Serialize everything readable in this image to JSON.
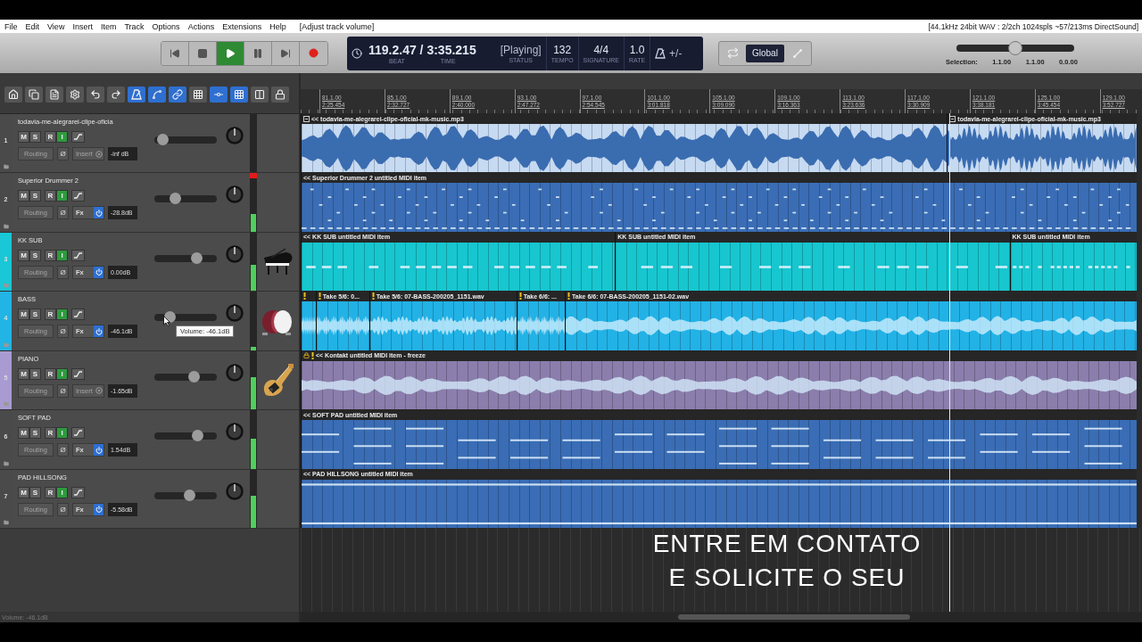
{
  "menu": [
    "File",
    "Edit",
    "View",
    "Insert",
    "Item",
    "Track",
    "Options",
    "Actions",
    "Extensions",
    "Help"
  ],
  "action_hint": "[Adjust track volume]",
  "audio_status": "[44.1kHz 24bit WAV : 2/2ch 1024spls ~57/213ms DirectSound]",
  "transport": {
    "buttons": [
      {
        "kind": "start",
        "selected": false
      },
      {
        "kind": "stop",
        "selected": false
      },
      {
        "kind": "play",
        "selected": true
      },
      {
        "kind": "pause",
        "selected": false
      },
      {
        "kind": "end",
        "selected": false
      },
      {
        "kind": "record",
        "selected": false
      }
    ],
    "position": "119.2.47 / 3:35.215",
    "position_labels": [
      "BEAT",
      "TIME"
    ],
    "fields": [
      {
        "value": "[Playing]",
        "label": "STATUS"
      },
      {
        "value": "132",
        "label": "TEMPO"
      },
      {
        "value": "4/4",
        "label": "SIGNATURE"
      },
      {
        "value": "1.0",
        "label": "RATE"
      }
    ],
    "metronome": "+/-",
    "mode": "Global",
    "master_slider": {
      "level": 0.5
    },
    "selection": {
      "label": "Selection:",
      "values": [
        "1.1.00",
        "1.1.00",
        "0.0.00"
      ]
    }
  },
  "toolbar": [
    {
      "kind": "home",
      "selected": false
    },
    {
      "kind": "copy",
      "selected": false
    },
    {
      "kind": "file",
      "selected": false
    },
    {
      "kind": "gear",
      "selected": false
    },
    {
      "kind": "undo",
      "selected": false
    },
    {
      "kind": "redo",
      "selected": false
    },
    {
      "kind": "metronome",
      "selected": true
    },
    {
      "kind": "curve",
      "selected": true
    },
    {
      "kind": "link",
      "selected": true
    },
    {
      "kind": "grid",
      "selected": false
    },
    {
      "kind": "snap",
      "selected": true
    },
    {
      "kind": "grid",
      "selected": true
    },
    {
      "kind": "split",
      "selected": false
    },
    {
      "kind": "lock",
      "selected": false
    }
  ],
  "ruler": [
    {
      "bar": "81.1.00",
      "time": "2:25.454"
    },
    {
      "bar": "85.1.00",
      "time": "2:32.727"
    },
    {
      "bar": "89.1.00",
      "time": "2:40.000"
    },
    {
      "bar": "93.1.00",
      "time": "2:47.272"
    },
    {
      "bar": "97.1.00",
      "time": "2:54.545"
    },
    {
      "bar": "101.1.00",
      "time": "3:01.818"
    },
    {
      "bar": "105.1.00",
      "time": "3:09.090"
    },
    {
      "bar": "109.1.00",
      "time": "3:16.363"
    },
    {
      "bar": "113.1.00",
      "time": "3:23.636"
    },
    {
      "bar": "117.1.00",
      "time": "3:30.909"
    },
    {
      "bar": "121.1.00",
      "time": "3:38.181"
    },
    {
      "bar": "125.1.00",
      "time": "3:45.454"
    },
    {
      "bar": "129.1.00",
      "time": "3:52.727"
    }
  ],
  "tracks": [
    {
      "number": "1",
      "name": "todavia-me-alegrarei-clipe-oficia",
      "color": "#4a4a4a",
      "buttons": [
        {
          "label": "M",
          "on": false
        },
        {
          "label": "S",
          "on": false
        },
        {
          "label": "R",
          "on": false
        },
        {
          "label": "I",
          "on": true
        }
      ],
      "routing": "Routing",
      "phase": "Ø",
      "fx_power": false,
      "fx_label": "Insert",
      "volume": "-inf dB",
      "fader": {
        "level": 0.05
      },
      "clip": false,
      "thumbnail": false,
      "items": [
        {
          "kind": "audio",
          "label": "<< todavia-me-alegrarei-clipe-oficial-mk-music.mp3",
          "color": "#c6daf2",
          "take_icon": true,
          "warning": false,
          "locked": false
        },
        {
          "kind": "audio",
          "label": "todavia-me-alegrarei-clipe-oficial-mk-music.mp3",
          "color": "#c6daf2",
          "take_icon": true,
          "warning": false,
          "locked": false
        }
      ]
    },
    {
      "number": "2",
      "name": "Superior Drummer 2",
      "color": "#4a4a4a",
      "buttons": [
        {
          "label": "M",
          "on": false
        },
        {
          "label": "S",
          "on": false
        },
        {
          "label": "R",
          "on": false
        },
        {
          "label": "I",
          "on": true
        }
      ],
      "routing": "Routing",
      "phase": "Ø",
      "fx_power": true,
      "fx_label": "Fx",
      "volume": "-28.8dB",
      "fader": {
        "level": 0.3
      },
      "meter": {
        "level": 0.3
      },
      "clip": true,
      "thumbnail": false,
      "items": [
        {
          "kind": "midi",
          "label": "<< Superior Drummer 2 untitled MIDI item",
          "color": "#3a6db5",
          "take_icon": false,
          "warning": false,
          "locked": false
        }
      ]
    },
    {
      "number": "3",
      "name": "KK SUB",
      "color": "#19c7d6",
      "buttons": [
        {
          "label": "M",
          "on": false
        },
        {
          "label": "S",
          "on": false
        },
        {
          "label": "R",
          "on": false
        },
        {
          "label": "I",
          "on": true
        }
      ],
      "routing": "Routing",
      "phase": "Ø",
      "fx_power": true,
      "fx_label": "Fx",
      "volume": "0.00dB",
      "fader": {
        "level": 0.72
      },
      "meter": {
        "level": 0.45
      },
      "clip": false,
      "thumbnail": true,
      "items": [
        {
          "kind": "midi",
          "label": "<< KK SUB untitled MIDI item",
          "color": "#17c6cf",
          "take_icon": false,
          "warning": false,
          "locked": false
        },
        {
          "kind": "midi",
          "label": "KK SUB untitled MIDI item",
          "color": "#17c6cf",
          "take_icon": false,
          "warning": false,
          "locked": false
        },
        {
          "kind": "midi",
          "label": "KK SUB untitled MIDI item",
          "color": "#17c6cf",
          "take_icon": false,
          "warning": false,
          "locked": false
        }
      ]
    },
    {
      "number": "4",
      "name": "BASS",
      "color": "#22b4e4",
      "buttons": [
        {
          "label": "M",
          "on": false
        },
        {
          "label": "S",
          "on": false
        },
        {
          "label": "R",
          "on": false
        },
        {
          "label": "I",
          "on": true
        }
      ],
      "routing": "Routing",
      "phase": "Ø",
      "fx_power": true,
      "fx_label": "Fx",
      "volume": "-46.1dB",
      "fader": {
        "level": 0.2
      },
      "meter": {
        "level": 0.05
      },
      "clip": false,
      "thumbnail": true,
      "items": [
        {
          "kind": "audio",
          "color": "#22b2e6",
          "take_icon": false,
          "warning": true,
          "locked": false
        },
        {
          "kind": "audio",
          "label": "Take 5/6: 0...",
          "color": "#22b2e6",
          "take_icon": false,
          "warning": true,
          "locked": false
        },
        {
          "kind": "audio",
          "label": "Take 5/6: 07-BASS-200205_1151.wav",
          "color": "#22b2e6",
          "take_icon": false,
          "warning": true,
          "locked": false
        },
        {
          "kind": "audio",
          "label": "Take 6/6: ...",
          "color": "#22b2e6",
          "take_icon": false,
          "warning": true,
          "locked": false
        },
        {
          "kind": "audio",
          "label": "Take 6/6: 07-BASS-200205_1151-02.wav",
          "color": "#22b2e6",
          "take_icon": false,
          "warning": true,
          "locked": false
        }
      ]
    },
    {
      "number": "5",
      "name": "PIANO",
      "color": "#a99bd2",
      "buttons": [
        {
          "label": "M",
          "on": false
        },
        {
          "label": "S",
          "on": false
        },
        {
          "label": "R",
          "on": false
        },
        {
          "label": "I",
          "on": true
        }
      ],
      "routing": "Routing",
      "phase": "Ø",
      "fx_power": false,
      "fx_label": "Insert",
      "volume": "-1.65dB",
      "fader": {
        "level": 0.66
      },
      "meter": {
        "level": 0.55
      },
      "clip": false,
      "thumbnail": true,
      "items": [
        {
          "kind": "audio",
          "label": "<< Kontakt untitled MIDI item - freeze",
          "color": "#8b7eac",
          "take_icon": false,
          "warning": true,
          "locked": true
        }
      ]
    },
    {
      "number": "6",
      "name": "SOFT PAD",
      "color": "#4a4a4a",
      "buttons": [
        {
          "label": "M",
          "on": false
        },
        {
          "label": "S",
          "on": false
        },
        {
          "label": "R",
          "on": false
        },
        {
          "label": "I",
          "on": true
        }
      ],
      "routing": "Routing",
      "phase": "Ø",
      "fx_power": true,
      "fx_label": "Fx",
      "volume": "1.54dB",
      "fader": {
        "level": 0.74
      },
      "meter": {
        "level": 0.52
      },
      "clip": false,
      "thumbnail": false,
      "items": [
        {
          "kind": "midi",
          "label": "<< SOFT PAD untitled MIDI item",
          "color": "#3a6db5",
          "take_icon": false,
          "warning": false,
          "locked": false
        }
      ]
    },
    {
      "number": "7",
      "name": "PAD HILLSONG",
      "color": "#4a4a4a",
      "buttons": [
        {
          "label": "M",
          "on": false
        },
        {
          "label": "S",
          "on": false
        },
        {
          "label": "R",
          "on": false
        },
        {
          "label": "I",
          "on": true
        }
      ],
      "routing": "Routing",
      "phase": "Ø",
      "fx_power": true,
      "fx_label": "Fx",
      "volume": "-5.58dB",
      "fader": {
        "level": 0.58
      },
      "meter": {
        "level": 0.55
      },
      "clip": false,
      "thumbnail": false,
      "items": [
        {
          "kind": "midi",
          "label": "<< PAD HILLSONG untitled MIDI item",
          "color": "#3a6db5",
          "take_icon": false,
          "warning": false,
          "locked": false
        }
      ]
    }
  ],
  "tooltip": "Volume: -46.1dB",
  "status_bar": "Volume: -46.1dB",
  "overlay": [
    "ENTRE EM CONTATO",
    "E SOLICITE O SEU"
  ]
}
